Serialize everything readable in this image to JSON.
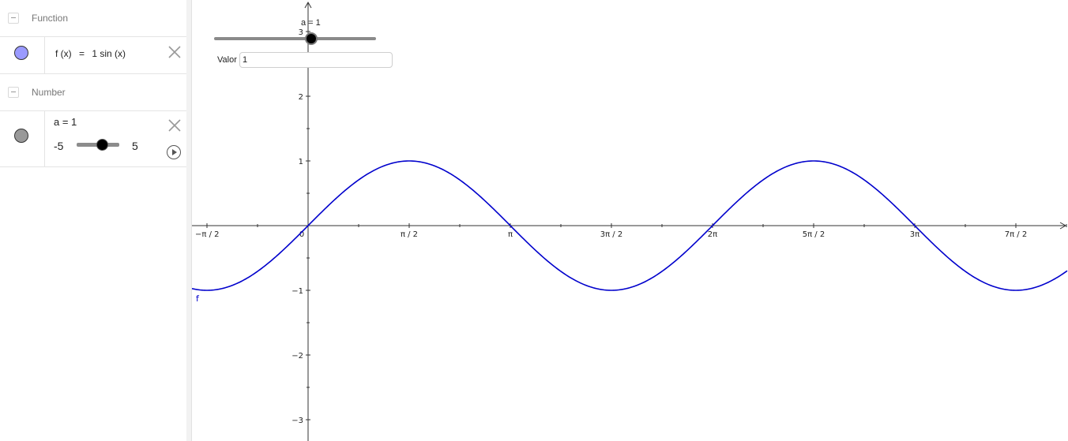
{
  "algebra": {
    "function_group": {
      "label": "Function"
    },
    "function_item": {
      "prefix": "f (x)",
      "eq": "=",
      "expr": "1  sin (x)",
      "color": "#9a9aff"
    },
    "number_group": {
      "label": "Number"
    },
    "number_item": {
      "definition": "a = 1",
      "slider_min": "-5",
      "slider_max": "5",
      "slider_value": 1,
      "color": "#999999"
    }
  },
  "graphics": {
    "slider": {
      "caption": "a = 1",
      "value": 1,
      "min": -5,
      "max": 5
    },
    "input": {
      "label": "Valor",
      "value": "1"
    },
    "function_label": "f",
    "curve_color": "#0000cc",
    "x_ticks": [
      "−π / 2",
      "0",
      "π / 2",
      "π",
      "3π / 2",
      "2π",
      "5π / 2",
      "3π",
      "7π / 2"
    ],
    "y_ticks": [
      "3",
      "2",
      "1",
      "−1",
      "−2",
      "−3"
    ]
  },
  "chart_data": {
    "type": "line",
    "series": [
      {
        "name": "f",
        "formula": "1 sin(x)",
        "amplitude": 1
      }
    ],
    "xlim": [
      -1.79,
      6.98
    ],
    "ylim": [
      -3.3,
      3.5
    ],
    "x_tick_values": [
      -1.5708,
      0,
      1.5708,
      3.1416,
      4.7124,
      6.2832,
      7.854,
      9.4248,
      10.9956
    ],
    "y_tick_values": [
      3,
      2,
      1,
      -1,
      -2,
      -3
    ],
    "grid": false
  }
}
